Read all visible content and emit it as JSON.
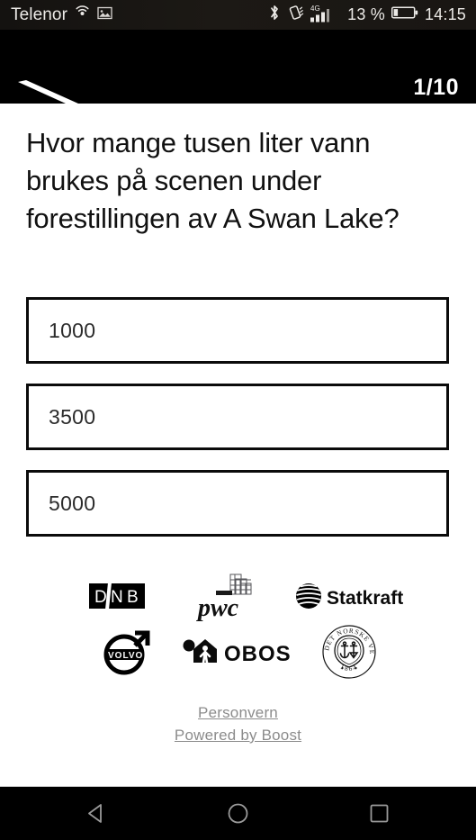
{
  "status_bar": {
    "carrier": "Telenor",
    "hotspot_icon": "wifi-hotspot-icon",
    "screenshot_icon": "image-icon",
    "bluetooth_icon": "bluetooth-icon",
    "vibrate_icon": "vibrate-icon",
    "network_type": "4G",
    "signal_icon": "signal-bars-icon",
    "battery_percent": "13 %",
    "battery_icon": "battery-icon",
    "clock": "14:15"
  },
  "header": {
    "logo_name": "slash-logo",
    "question_counter": "1/10",
    "background_color": "#000000"
  },
  "quiz": {
    "question": "Hvor mange tusen liter vann brukes på scenen under forestillingen av A Swan Lake?",
    "answers": [
      {
        "label": "1000"
      },
      {
        "label": "3500"
      },
      {
        "label": "5000"
      }
    ]
  },
  "sponsors": {
    "rows": [
      [
        {
          "name": "DNB",
          "icon": "dnb-logo"
        },
        {
          "name": "pwc",
          "icon": "pwc-logo"
        },
        {
          "name": "Statkraft",
          "icon": "statkraft-logo"
        }
      ],
      [
        {
          "name": "VOLVO",
          "icon": "volvo-logo"
        },
        {
          "name": "OBOS",
          "icon": "obos-logo"
        },
        {
          "name": "DET NORSKE VERITAS 1864",
          "icon": "dnv-logo"
        }
      ]
    ]
  },
  "footer": {
    "privacy_link": "Personvern",
    "powered_by_link": "Powered by Boost"
  },
  "navigation_bar": {
    "back": "back-icon",
    "home": "home-icon",
    "recents": "recents-icon"
  }
}
